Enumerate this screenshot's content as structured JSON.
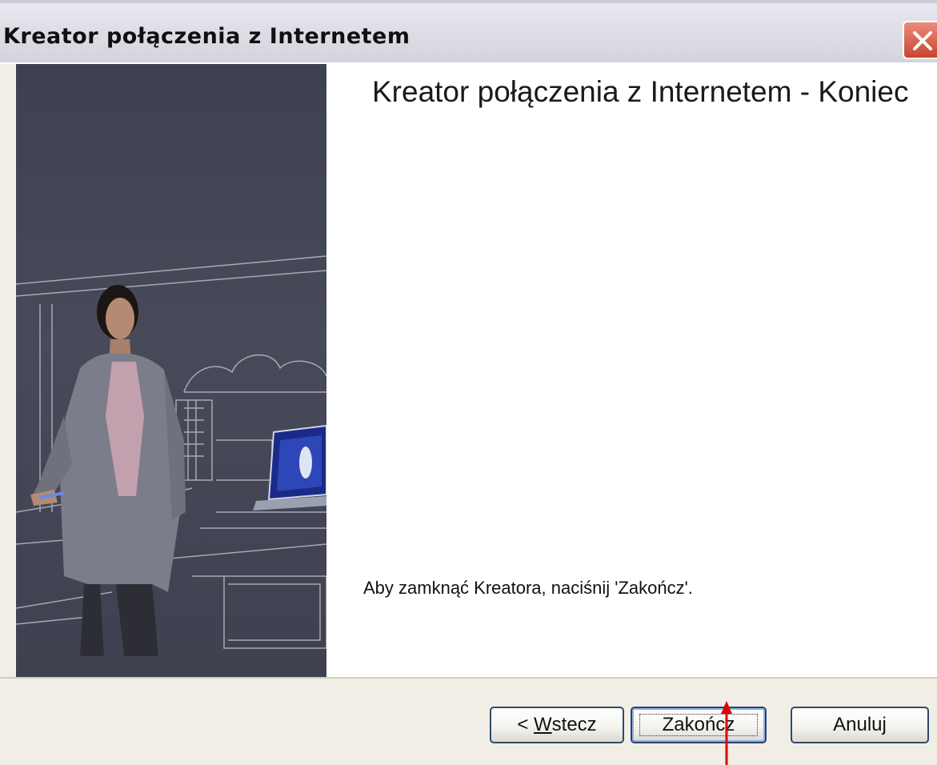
{
  "window": {
    "title": "Kreator połączenia z Internetem"
  },
  "content": {
    "heading": "Kreator połączenia z Internetem - Koniec",
    "instruction": "Aby zamknąć Kreatora, naciśnij 'Zakończ'."
  },
  "buttons": {
    "back_prefix": "< ",
    "back_mnemonic": "W",
    "back_rest": "stecz",
    "finish": "Zakończ",
    "cancel": "Anuluj"
  },
  "icons": {
    "close": "close-icon",
    "pointer": "red-arrow-pointer"
  },
  "colors": {
    "sidebar_bg": "#434655",
    "bottom_bar_bg": "#f1efe5",
    "close_button": "#d25a44",
    "pointer_arrow": "#e00000"
  }
}
